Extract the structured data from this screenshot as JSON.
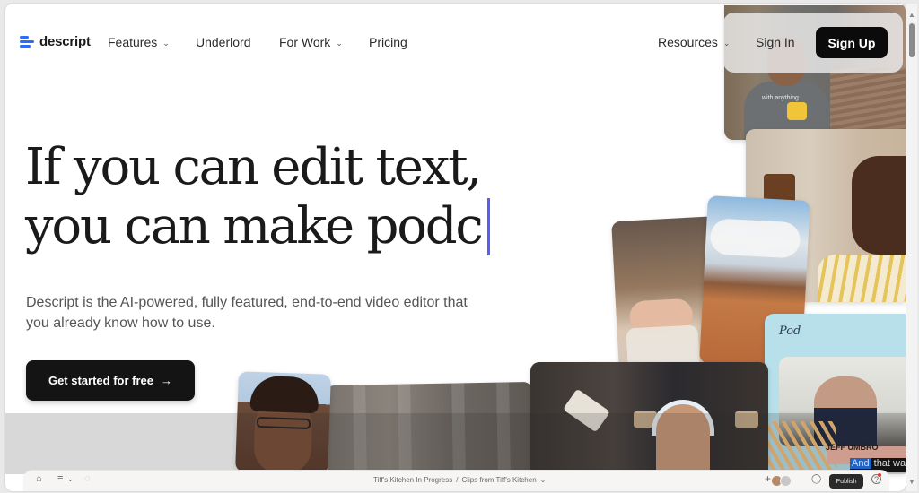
{
  "nav": {
    "logo_text": "descript",
    "items": [
      {
        "label": "Features",
        "has_dropdown": true
      },
      {
        "label": "Underlord",
        "has_dropdown": false
      },
      {
        "label": "For Work",
        "has_dropdown": true
      },
      {
        "label": "Pricing",
        "has_dropdown": false
      }
    ],
    "resources_label": "Resources",
    "signin_label": "Sign In",
    "signup_label": "Sign Up",
    "chevron_glyph": "⌄"
  },
  "hero": {
    "headline_line1": "If you can edit text,",
    "headline_line2": "you can make podc",
    "subheadline": "Descript is the AI-powered, fully featured, end-to-end video editor that you already know how to use.",
    "cta_label": "Get started for free",
    "cta_arrow": "→",
    "caret_color": "#5a5ef0"
  },
  "collage": {
    "tiktok_shirt_text": "with anything",
    "podcast_guest_name": "JEFF UMBRO",
    "caption_highlight": "And",
    "caption_rest": " that wa",
    "podcast_logo": "Pod"
  },
  "editor_bar": {
    "home_icon": "⌂",
    "menu_icon": "≡",
    "menu_chevron": "⌄",
    "check_icon": "◌",
    "breadcrumb_project": "Tiff's Kitchen In Progress",
    "breadcrumb_separator": "/",
    "breadcrumb_composition": "Clips from Tiff's Kitchen",
    "breadcrumb_chevron": "⌄",
    "add_icon": "+",
    "comment_icon": "◯",
    "publish_label": "Publish",
    "help_icon": "?"
  },
  "scrollbar": {
    "up_glyph": "▲",
    "down_glyph": "▼"
  },
  "colors": {
    "brand_blue": "#2b6ef5",
    "button_dark": "#0b0b0b",
    "caption_highlight": "#1e6fe8"
  }
}
